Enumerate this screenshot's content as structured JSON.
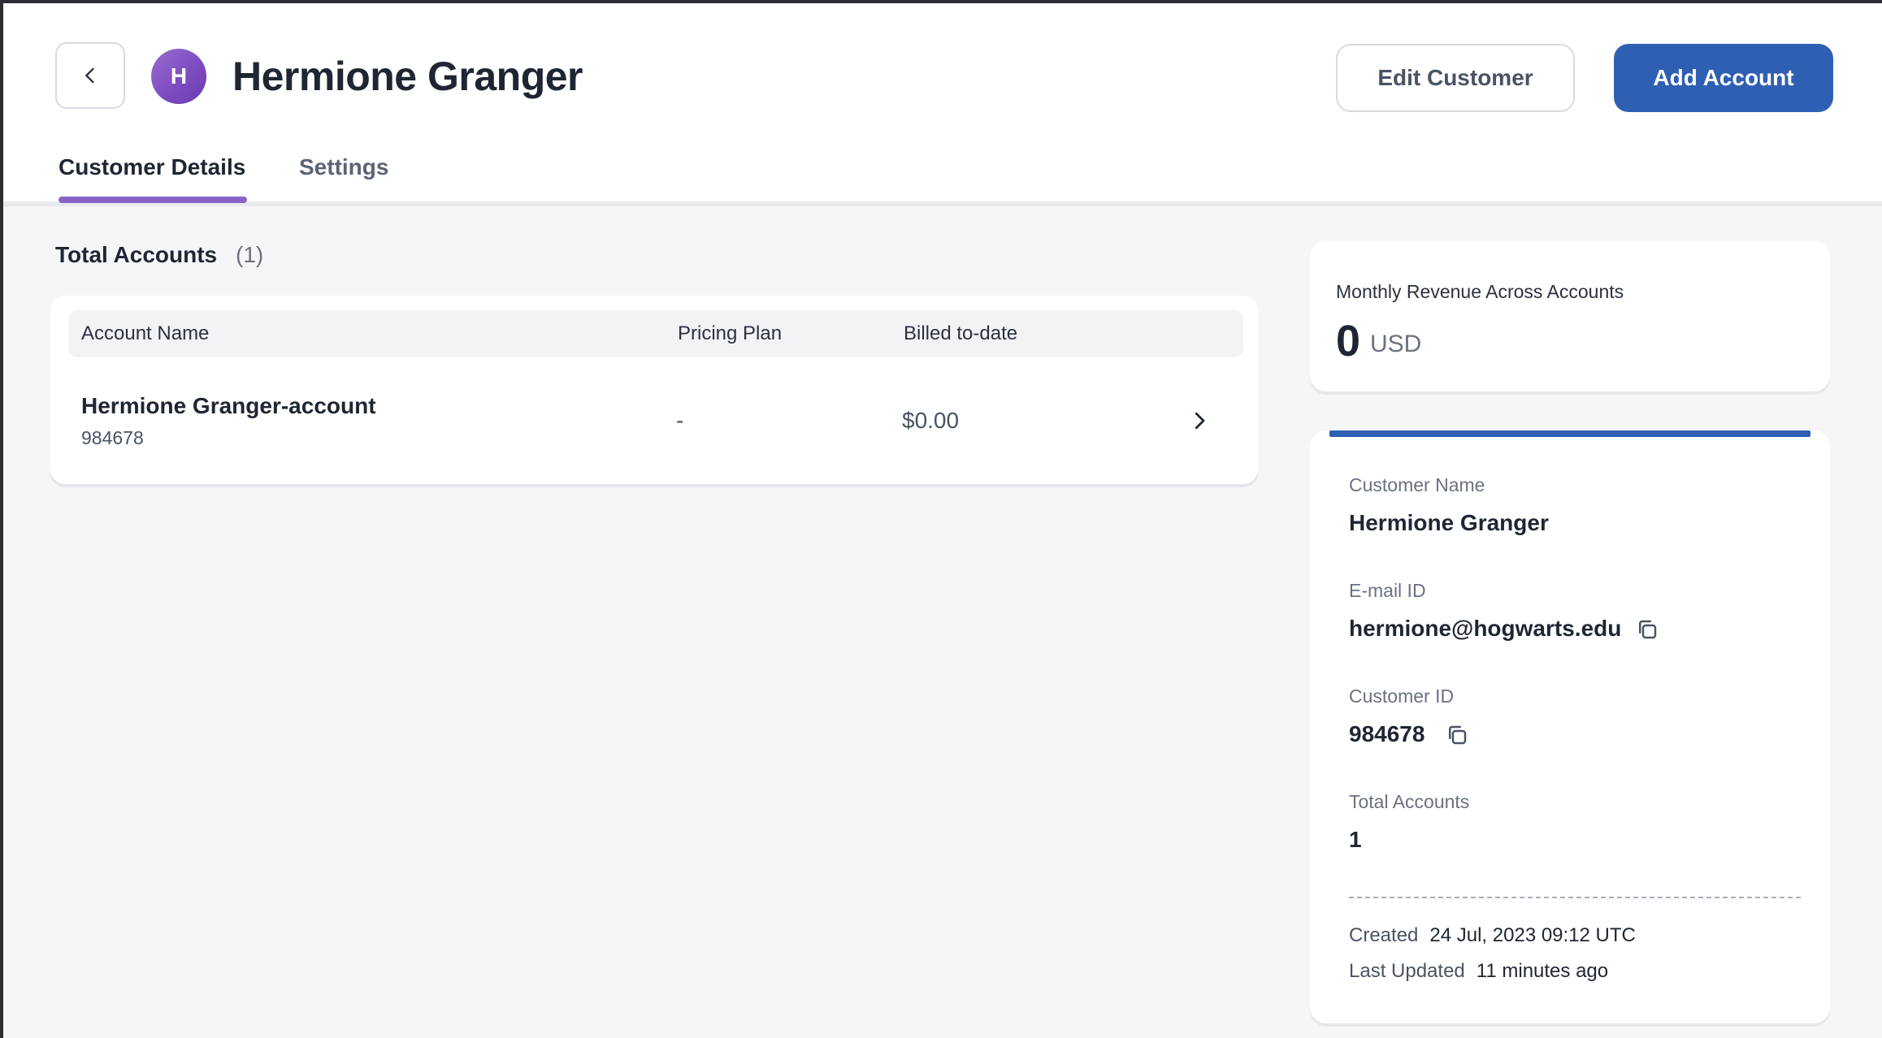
{
  "header": {
    "avatar_initial": "H",
    "title": "Hermione Granger",
    "edit_button": "Edit Customer",
    "add_button": "Add Account",
    "tabs": [
      {
        "label": "Customer Details",
        "active": true
      },
      {
        "label": "Settings",
        "active": false
      }
    ]
  },
  "accounts": {
    "title": "Total Accounts",
    "count": "(1)",
    "columns": [
      "Account Name",
      "Pricing Plan",
      "Billed to-date"
    ],
    "rows": [
      {
        "name": "Hermione Granger-account",
        "id": "984678",
        "plan": "-",
        "billed": "$0.00"
      }
    ]
  },
  "revenue": {
    "label": "Monthly Revenue Across Accounts",
    "value": "0",
    "unit": "USD"
  },
  "details": {
    "customer_name_label": "Customer Name",
    "customer_name": "Hermione Granger",
    "email_label": "E-mail ID",
    "email": "hermione@hogwarts.edu",
    "customer_id_label": "Customer ID",
    "customer_id": "984678",
    "total_accounts_label": "Total Accounts",
    "total_accounts": "1",
    "created_label": "Created",
    "created": "24 Jul, 2023 09:12 UTC",
    "updated_label": "Last Updated",
    "updated": "11 minutes ago"
  },
  "colors": {
    "primary": "#2f5fb3",
    "tab_accent": "#8a63c8",
    "avatar": "#7d4cc0"
  },
  "icons": [
    "chevron-left-icon",
    "chevron-right-icon",
    "copy-icon"
  ]
}
